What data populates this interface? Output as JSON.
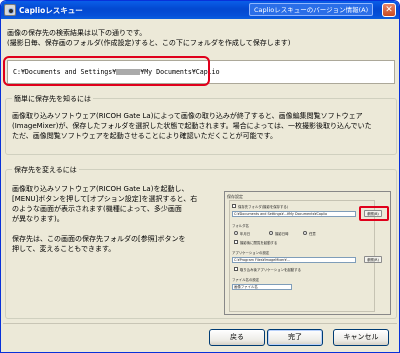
{
  "window": {
    "title": "Caplioレスキュー",
    "title_menu": "Caplioレスキューのバージョン情報(A)",
    "close_glyph": "✕"
  },
  "intro": {
    "line1": "画像の保存先の検索結果は以下の通りです。",
    "line2": "(撮影日毎、保存画のフォルダ(作成設定)すると、この下にフォルダを作成して保存します)"
  },
  "path": {
    "prefix": "C:¥Documents and Settings¥",
    "suffix": "¥My Documents¥Caplio"
  },
  "group_method": {
    "title": "簡単に保存先を知るには",
    "body": [
      "画像取り込みソフトウェア(RICOH Gate La)によって画像の取り込みが終了すると、画像編集閲覧ソフトウェア",
      "(ImageMixer)が、保存したフォルダを選択した状態で起動されます。場合によっては、一枚撮影後取り込んでいた",
      "ただ、画像閲覧ソフトウェアを起動させることにより確認いただくことが可能です。"
    ]
  },
  "group_change": {
    "title": "保存先を変えるには",
    "body": [
      "画像取り込みソフトウェア(RICOH Gate La)を起動し、",
      "[MENU]ボタンを押して[オプション設定]を選択すると、右",
      "のような画面が表示されます(機種によって、多少画面",
      "が異なります)。",
      "",
      "保存先は、この画面の保存先フォルダの[参照]ボタンを",
      "押して、変えることもできます。"
    ]
  },
  "screenshot": {
    "title": "保存設定",
    "row1": "保存先フォルダ(撮影を保存する)",
    "path1": "C:¥Documents and Settings¥...¥My Documents¥Caplio",
    "browse": "参照(B)",
    "section2": "フォルダ名",
    "option1": "年月日",
    "option2": "撮影日時",
    "option3": "任意",
    "check1": "撮影後に閲覧を起動する",
    "section3": "アプリケーションの設定",
    "path2": "C:¥Program Files¥ImageMixer¥...",
    "browse2": "参照(R)",
    "check2": "取り込み後アプリケーションを起動する",
    "section4": "ファイル名の設定",
    "field4": "画像ファイル名"
  },
  "buttons": {
    "back": "戻る",
    "finish": "完了",
    "cancel": "キャンセル"
  },
  "colors": {
    "titlebar": "#0348d0",
    "highlight": "#e0001b",
    "background": "#ece9d8"
  }
}
